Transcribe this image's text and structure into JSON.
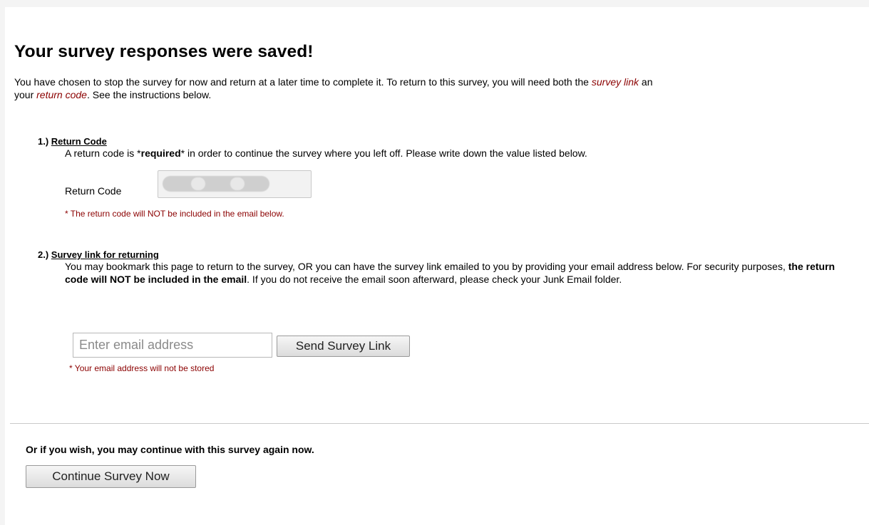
{
  "header": {
    "title": "Your survey responses were saved!"
  },
  "intro": {
    "part1": "You have chosen to stop the survey for now and return at a later time to complete it. To return to this survey, you will need both the ",
    "survey_link": "survey link",
    "part2": " an",
    "part3": "your ",
    "return_code": "return code",
    "part4": ". See the instructions below."
  },
  "section1": {
    "number": "1.) ",
    "title": "Return Code",
    "body_part1": "A return code is *",
    "body_required": "required",
    "body_part2": "* in order to continue the survey where you left off. Please write down the value listed below.",
    "field_label": "Return Code",
    "note": "* The return code will NOT be included in the email below."
  },
  "section2": {
    "number": "2.) ",
    "title": "Survey link for returning",
    "body_part1": "You may bookmark this page to return to the survey, OR you can have the survey link emailed to you by providing your email address below. For security purposes, ",
    "body_bold": "the return code will NOT be included in the email",
    "body_part2": ". If you do not receive the email soon afterward, please check your Junk Email folder.",
    "email_placeholder": "Enter email address",
    "email_value": "",
    "send_button": "Send Survey Link",
    "note": "* Your email address will not be stored"
  },
  "continue": {
    "text": "Or if you wish, you may continue with this survey again now.",
    "button": "Continue Survey Now"
  }
}
